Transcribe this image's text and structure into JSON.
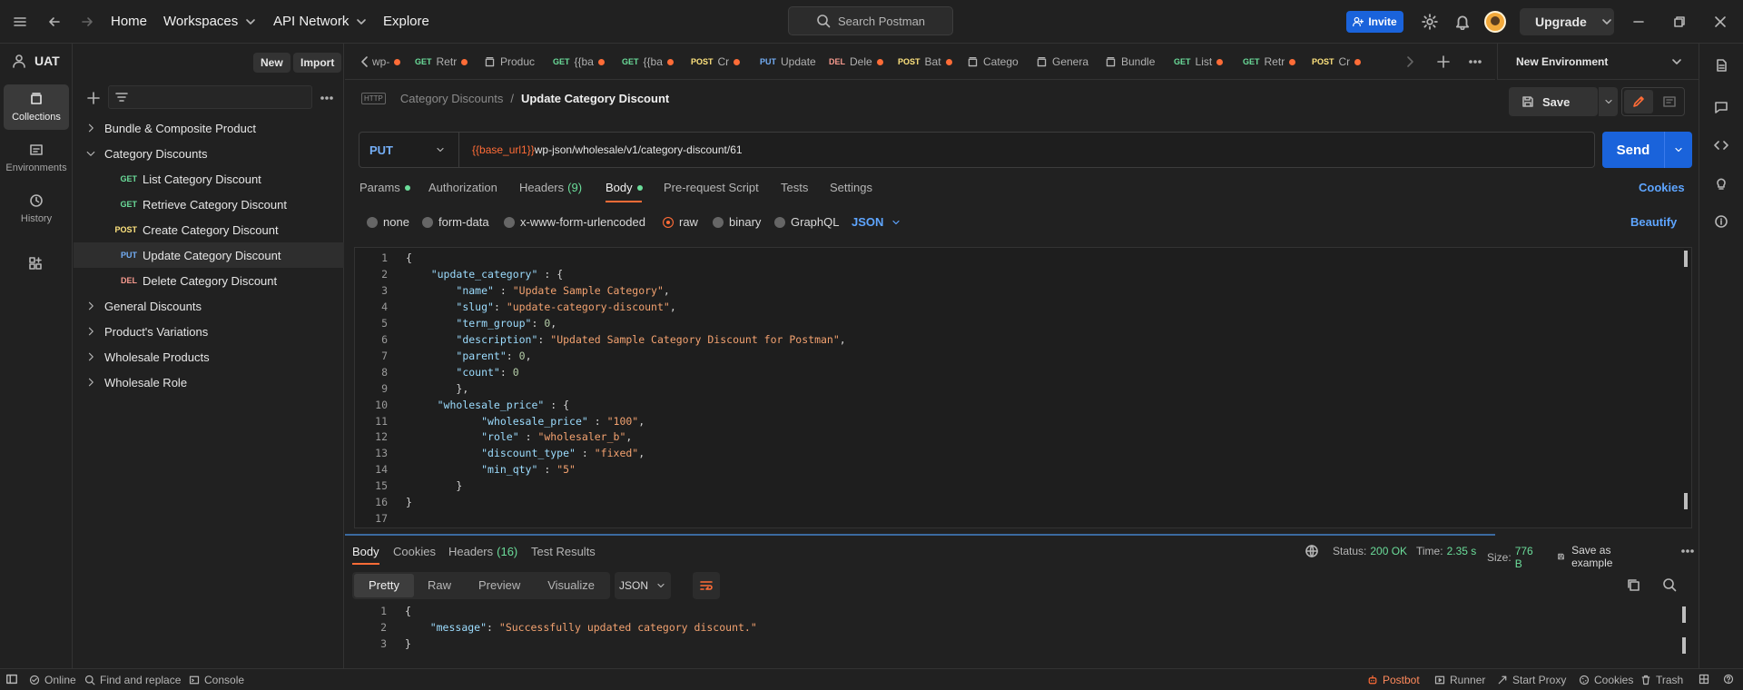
{
  "topbar": {
    "home": "Home",
    "workspaces": "Workspaces",
    "api_network": "API Network",
    "explore": "Explore",
    "search_placeholder": "Search Postman",
    "invite": "Invite",
    "upgrade": "Upgrade"
  },
  "workspace": {
    "name": "UAT",
    "new": "New",
    "import": "Import"
  },
  "rail": [
    {
      "label": "Collections",
      "icon": "collections-icon"
    },
    {
      "label": "Environments",
      "icon": "environments-icon"
    },
    {
      "label": "History",
      "icon": "history-icon"
    }
  ],
  "tree": [
    {
      "type": "folder",
      "label": "Bundle & Composite Product",
      "open": false
    },
    {
      "type": "folder",
      "label": "Category Discounts",
      "open": true
    },
    {
      "type": "request",
      "method": "GET",
      "label": "List Category Discount"
    },
    {
      "type": "request",
      "method": "GET",
      "label": "Retrieve Category Discount"
    },
    {
      "type": "request",
      "method": "POST",
      "label": "Create Category Discount"
    },
    {
      "type": "request",
      "method": "PUT",
      "label": "Update Category Discount",
      "selected": true
    },
    {
      "type": "request",
      "method": "DEL",
      "label": "Delete Category Discount"
    },
    {
      "type": "folder",
      "label": "General Discounts",
      "open": false
    },
    {
      "type": "folder",
      "label": "Product's Variations",
      "open": false
    },
    {
      "type": "folder",
      "label": "Wholesale Products",
      "open": false
    },
    {
      "type": "folder",
      "label": "Wholesale Role",
      "open": false
    }
  ],
  "tabs": [
    {
      "method": "",
      "label": "wp-",
      "dot": true
    },
    {
      "method": "GET",
      "label": "Retr",
      "dot": true
    },
    {
      "method": "",
      "label": "Produc",
      "dot": false
    },
    {
      "method": "GET",
      "label": "{{ba",
      "dot": true
    },
    {
      "method": "GET",
      "label": "{{ba",
      "dot": true
    },
    {
      "method": "POST",
      "label": "Cr",
      "dot": true
    },
    {
      "method": "PUT",
      "label": "Update",
      "dot": false
    },
    {
      "method": "DEL",
      "label": "Dele",
      "dot": true
    },
    {
      "method": "POST",
      "label": "Bat",
      "dot": true
    },
    {
      "method": "",
      "label": "Catego",
      "dot": false
    },
    {
      "method": "",
      "label": "Genera",
      "dot": false
    },
    {
      "method": "",
      "label": "Bundle",
      "dot": false
    },
    {
      "method": "GET",
      "label": "List",
      "dot": true
    },
    {
      "method": "GET",
      "label": "Retr",
      "dot": true
    },
    {
      "method": "POST",
      "label": "Cr",
      "dot": true
    }
  ],
  "environment": {
    "label": "New Environment"
  },
  "breadcrumb": {
    "parent": "Category Discounts",
    "separator": "/",
    "current": "Update Category Discount",
    "badge": "HTTP"
  },
  "save": {
    "label": "Save"
  },
  "request": {
    "method": "PUT",
    "url_var": "{{base_url1}}",
    "url_path": "wp-json/wholesale/v1/category-discount/61",
    "send": "Send"
  },
  "req_tabs": {
    "params": "Params",
    "authorization": "Authorization",
    "headers": "Headers",
    "headers_count": "(9)",
    "body": "Body",
    "prerequest": "Pre-request Script",
    "tests": "Tests",
    "settings": "Settings",
    "cookies": "Cookies"
  },
  "body_modes": {
    "none": "none",
    "form_data": "form-data",
    "urlencoded": "x-www-form-urlencoded",
    "raw": "raw",
    "binary": "binary",
    "graphql": "GraphQL",
    "format": "JSON",
    "beautify": "Beautify"
  },
  "code_lines": [
    {
      "n": "1",
      "t": "{"
    },
    {
      "n": "2",
      "t": "    \"update_category\" : {"
    },
    {
      "n": "3",
      "t": "        \"name\" : \"Update Sample Category\","
    },
    {
      "n": "4",
      "t": "        \"slug\": \"update-category-discount\","
    },
    {
      "n": "5",
      "t": "        \"term_group\": 0,"
    },
    {
      "n": "6",
      "t": "        \"description\": \"Updated Sample Category Discount for Postman\","
    },
    {
      "n": "7",
      "t": "        \"parent\": 0,"
    },
    {
      "n": "8",
      "t": "        \"count\": 0"
    },
    {
      "n": "9",
      "t": "        },"
    },
    {
      "n": "10",
      "t": "     \"wholesale_price\" : {"
    },
    {
      "n": "11",
      "t": "            \"wholesale_price\" : \"100\","
    },
    {
      "n": "12",
      "t": "            \"role\" : \"wholesaler_b\","
    },
    {
      "n": "13",
      "t": "            \"discount_type\" : \"fixed\","
    },
    {
      "n": "14",
      "t": "            \"min_qty\" : \"5\""
    },
    {
      "n": "15",
      "t": "        }"
    },
    {
      "n": "16",
      "t": "}"
    },
    {
      "n": "17",
      "t": ""
    }
  ],
  "response": {
    "tabs": [
      "Body",
      "Cookies",
      "Headers",
      "Test Results"
    ],
    "headers_count": "(16)",
    "status_label": "Status:",
    "status": "200 OK",
    "time_label": "Time:",
    "time": "2.35 s",
    "size_label": "Size:",
    "size": "776 B",
    "save_example": "Save as example",
    "views": [
      "Pretty",
      "Raw",
      "Preview",
      "Visualize"
    ],
    "format": "JSON",
    "lines": [
      {
        "n": "1",
        "t": "{"
      },
      {
        "n": "2",
        "t": "    \"message\": \"Successfully updated category discount.\""
      },
      {
        "n": "3",
        "t": "}"
      }
    ]
  },
  "statusbar": {
    "online": "Online",
    "find": "Find and replace",
    "console": "Console",
    "postbot": "Postbot",
    "runner": "Runner",
    "proxy": "Start Proxy",
    "cookies": "Cookies",
    "trash": "Trash"
  },
  "colors": {
    "accent": "#ff6c37",
    "send": "#1a63db",
    "success": "#6bdd9a"
  }
}
